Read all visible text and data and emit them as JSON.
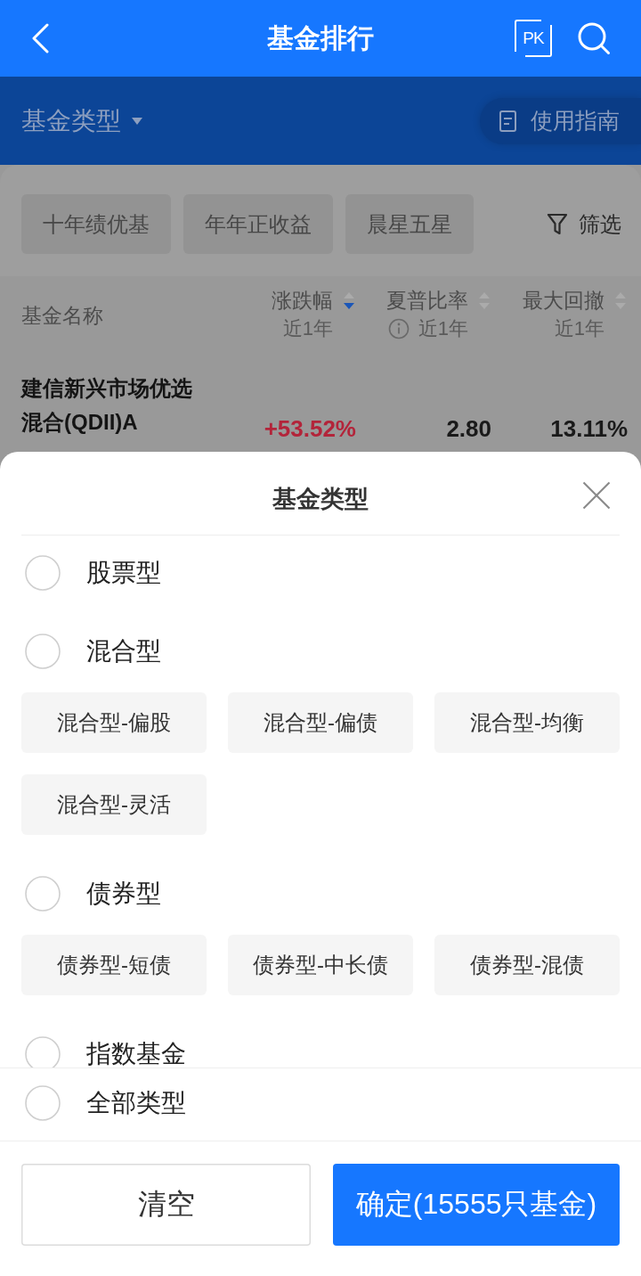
{
  "top_bar": {
    "title": "基金排行",
    "pk_label": "PK"
  },
  "filter_bar": {
    "fund_type": "基金类型",
    "guide": "使用指南"
  },
  "quick_filters": {
    "chips": [
      {
        "label": "十年绩优基",
        "selected": false
      },
      {
        "label": "年年正收益",
        "selected": false
      },
      {
        "label": "晨星五星",
        "selected": false
      }
    ],
    "filter_button": "筛选"
  },
  "table": {
    "columns": [
      {
        "title": "基金名称",
        "kind": "name"
      },
      {
        "title": "涨跌幅",
        "kind": "metric",
        "period": "近1年",
        "sorted": true,
        "info": false
      },
      {
        "title": "夏普比率",
        "kind": "metric",
        "period": "近1年",
        "sorted": false,
        "info": true
      },
      {
        "title": "最大回撤",
        "kind": "metric",
        "period": "近1年",
        "sorted": false,
        "info": false
      }
    ],
    "rows": [
      {
        "name": "建信新兴市场优选混合(QDII)A",
        "values": [
          {
            "text": "+53.52%",
            "rising": true
          },
          {
            "text": "2.80",
            "rising": false
          },
          {
            "text": "13.11%",
            "rising": false
          }
        ]
      }
    ]
  },
  "sheet": {
    "title": "基金类型",
    "categories": [
      {
        "label": "股票型",
        "selected": false
      },
      {
        "label": "混合型",
        "selected": false,
        "children": [
          {
            "label": "混合型-偏股",
            "selected": false
          },
          {
            "label": "混合型-偏债",
            "selected": false
          },
          {
            "label": "混合型-均衡",
            "selected": false
          },
          {
            "label": "混合型-灵活",
            "selected": false
          }
        ]
      },
      {
        "label": "债券型",
        "selected": false,
        "children": [
          {
            "label": "债券型-短债",
            "selected": false
          },
          {
            "label": "债券型-中长债",
            "selected": false
          },
          {
            "label": "债券型-混债",
            "selected": false
          }
        ]
      },
      {
        "label": "指数基金",
        "selected": false
      }
    ],
    "all_types": {
      "label": "全部类型",
      "selected": false
    },
    "buttons": [
      {
        "label": "清空",
        "kind": "secondary"
      },
      {
        "label": "确定(15555只基金)",
        "kind": "primary"
      }
    ]
  }
}
